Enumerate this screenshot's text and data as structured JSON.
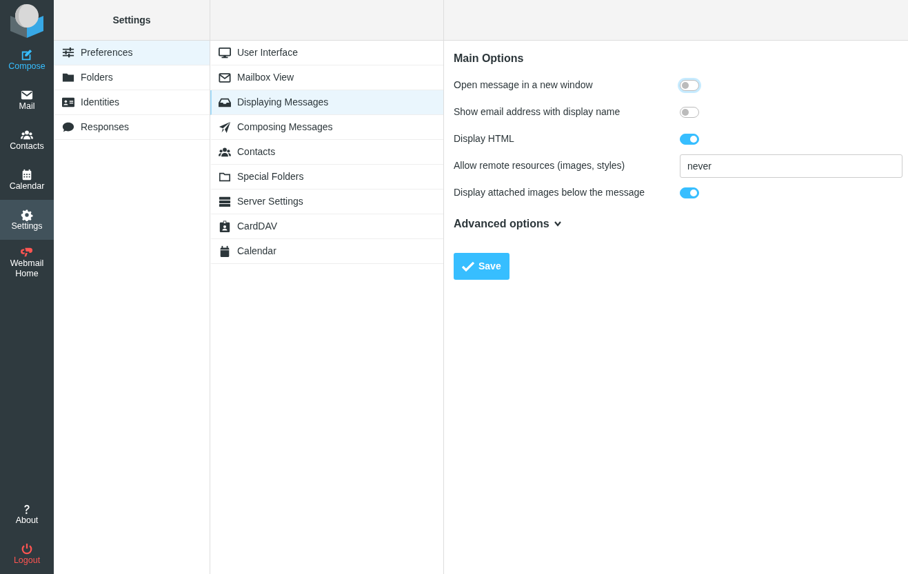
{
  "nav": {
    "items": [
      {
        "label": "Compose",
        "kind": "accent",
        "selected": false
      },
      {
        "label": "Mail",
        "kind": "plain",
        "selected": false
      },
      {
        "label": "Contacts",
        "kind": "plain",
        "selected": false
      },
      {
        "label": "Calendar",
        "kind": "plain",
        "selected": false
      },
      {
        "label": "Settings",
        "kind": "plain",
        "selected": true
      },
      {
        "label": "Webmail Home",
        "kind": "brand",
        "selected": false
      }
    ],
    "bottom": [
      {
        "label": "About",
        "kind": "plain"
      },
      {
        "label": "Logout",
        "kind": "danger"
      }
    ]
  },
  "settings": {
    "title": "Settings",
    "items": [
      {
        "label": "Preferences",
        "selected": true
      },
      {
        "label": "Folders",
        "selected": false
      },
      {
        "label": "Identities",
        "selected": false
      },
      {
        "label": "Responses",
        "selected": false
      }
    ]
  },
  "sections": {
    "items": [
      {
        "label": "User Interface",
        "selected": false
      },
      {
        "label": "Mailbox View",
        "selected": false
      },
      {
        "label": "Displaying Messages",
        "selected": true
      },
      {
        "label": "Composing Messages",
        "selected": false
      },
      {
        "label": "Contacts",
        "selected": false
      },
      {
        "label": "Special Folders",
        "selected": false
      },
      {
        "label": "Server Settings",
        "selected": false
      },
      {
        "label": "CardDAV",
        "selected": false
      },
      {
        "label": "Calendar",
        "selected": false
      }
    ]
  },
  "content": {
    "title": "Main Options",
    "options": [
      {
        "kind": "toggle",
        "label": "Open message in a new window",
        "on": false,
        "focused": true
      },
      {
        "kind": "toggle",
        "label": "Show email address with display name",
        "on": false,
        "focused": false
      },
      {
        "kind": "toggle",
        "label": "Display HTML",
        "on": true,
        "focused": false
      },
      {
        "kind": "select",
        "label": "Allow remote resources (images, styles)",
        "value": "never"
      },
      {
        "kind": "toggle",
        "label": "Display attached images below the message",
        "on": true,
        "focused": false
      }
    ],
    "advanced": {
      "label": "Advanced options",
      "expanded": false
    },
    "save": "Save"
  }
}
